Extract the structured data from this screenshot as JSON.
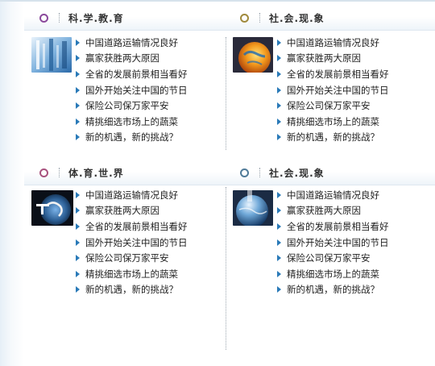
{
  "sections": [
    {
      "left": {
        "title": "科.学.教.育",
        "ring_color": "#8b4a9c",
        "thumb_icon": "blue-abstract-image",
        "items": [
          "中国道路运输情况良好",
          "赢家获胜两大原因",
          "全省的发展前景相当看好",
          "国外开始关注中国的节日",
          "保险公司保万家平安",
          "精挑细选市场上的蔬菜",
          "新的机遇，新的挑战？"
        ]
      },
      "right": {
        "title": "社.会.现.象",
        "ring_color": "#a08a3c",
        "thumb_icon": "orange-globe-image",
        "items": [
          "中国道路运输情况良好",
          "赢家获胜两大原因",
          "全省的发展前景相当看好",
          "国外开始关注中国的节日",
          "保险公司保万家平安",
          "精挑细选市场上的蔬菜",
          "新的机遇，新的挑战？"
        ]
      }
    },
    {
      "left": {
        "title": "体.育.世.界",
        "ring_color": "#a8527e",
        "thumb_icon": "dark-globe-image",
        "items": [
          "中国道路运输情况良好",
          "赢家获胜两大原因",
          "全省的发展前景相当看好",
          "国外开始关注中国的节日",
          "保险公司保万家平安",
          "精挑细选市场上的蔬菜",
          "新的机遇，新的挑战？"
        ]
      },
      "right": {
        "title": "社.会.现.象",
        "ring_color": "#4f7a98",
        "thumb_icon": "blue-globe-image",
        "items": [
          "中国道路运输情况良好",
          "赢家获胜两大原因",
          "全省的发展前景相当看好",
          "国外开始关注中国的节日",
          "保险公司保万家平安",
          "精挑细选市场上的蔬菜",
          "新的机遇，新的挑战？"
        ]
      }
    }
  ],
  "colors": {
    "arrow": "#2a7ab8",
    "accent_line": "#dfe8f0"
  }
}
